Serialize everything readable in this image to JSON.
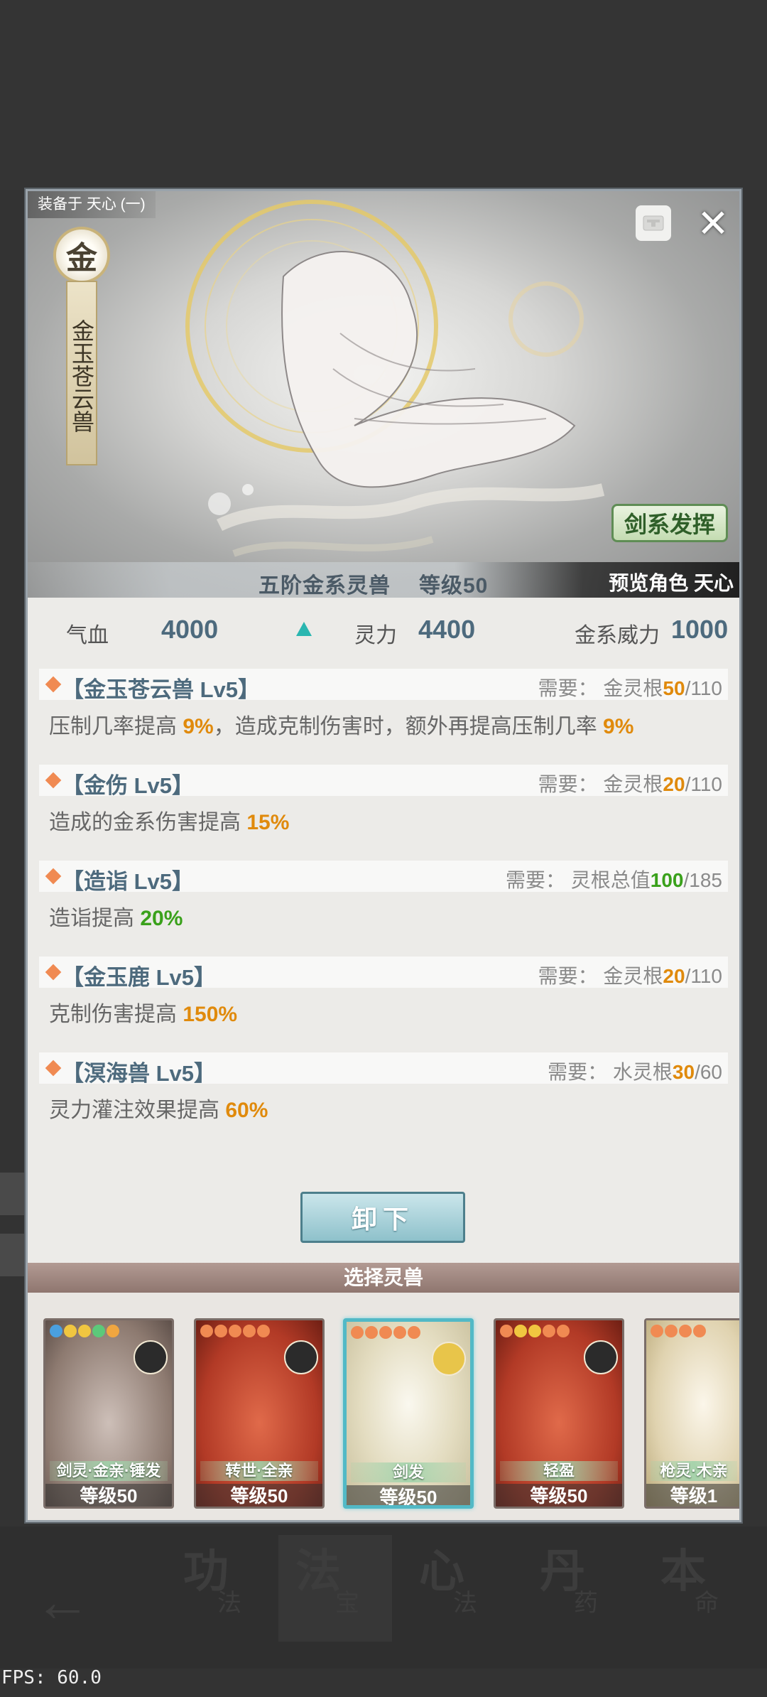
{
  "header": {
    "equipped_label": "装备于 天心 (一)",
    "element_glyph": "金",
    "beast_name": "金玉苍云兽",
    "sword_button": "剑系发挥",
    "rank": "五阶金系灵兽",
    "level": "等级50",
    "preview": "预览角色 天心"
  },
  "stats": {
    "hp_label": "气血",
    "hp_value": "4000",
    "spirit_label": "灵力",
    "spirit_value": "4400",
    "power_label": "金系威力",
    "power_value": "1000"
  },
  "skills": [
    {
      "name": "【金玉苍云兽 Lv5】",
      "req_label": "需要：",
      "req_name": "金灵根",
      "req_current": "50",
      "req_total": "/110",
      "desc_a": "压制几率提高 ",
      "desc_b": "9%",
      "desc_c": "，造成克制伤害时，额外再提高压制几率 ",
      "desc_d": "9%"
    },
    {
      "name": "【金伤 Lv5】",
      "req_label": "需要：",
      "req_name": "金灵根",
      "req_current": "20",
      "req_total": "/110",
      "desc_a": "造成的金系伤害提高 ",
      "desc_b": "15%"
    },
    {
      "name": "【造诣 Lv5】",
      "req_label": "需要：",
      "req_name": "灵根总值",
      "req_current": "100",
      "req_total": "/185",
      "desc_a": "造诣提高 ",
      "desc_b": "20%"
    },
    {
      "name": "【金玉鹿 Lv5】",
      "req_label": "需要：",
      "req_name": "金灵根",
      "req_current": "20",
      "req_total": "/110",
      "desc_a": "克制伤害提高 ",
      "desc_b": "150%"
    },
    {
      "name": "【溟海兽 Lv5】",
      "req_label": "需要：",
      "req_name": "水灵根",
      "req_current": "30",
      "req_total": "/60",
      "desc_a": "灵力灌注效果提高 ",
      "desc_b": "60%"
    }
  ],
  "unequip_button": "卸下",
  "select_title": "选择灵兽",
  "cards": [
    {
      "title": "剑灵·金亲·锤发",
      "level": "等级50"
    },
    {
      "title": "转世·全亲",
      "level": "等级50"
    },
    {
      "title": "剑发",
      "level": "等级50"
    },
    {
      "title": "轻盈",
      "level": "等级50"
    },
    {
      "title": "枪灵·木亲",
      "level": "等级1"
    }
  ],
  "nav": [
    {
      "big": "功",
      "small": "法"
    },
    {
      "big": "法",
      "small": "宝"
    },
    {
      "big": "心",
      "small": "法"
    },
    {
      "big": "丹",
      "small": "药"
    },
    {
      "big": "本",
      "small": "命"
    }
  ],
  "fps": "FPS: 60.0",
  "colors": {
    "accent": "#4d6a7d",
    "highlight_orange": "#e08a0c",
    "highlight_green": "#3aa11b",
    "selected_card": "#52b9c6"
  }
}
